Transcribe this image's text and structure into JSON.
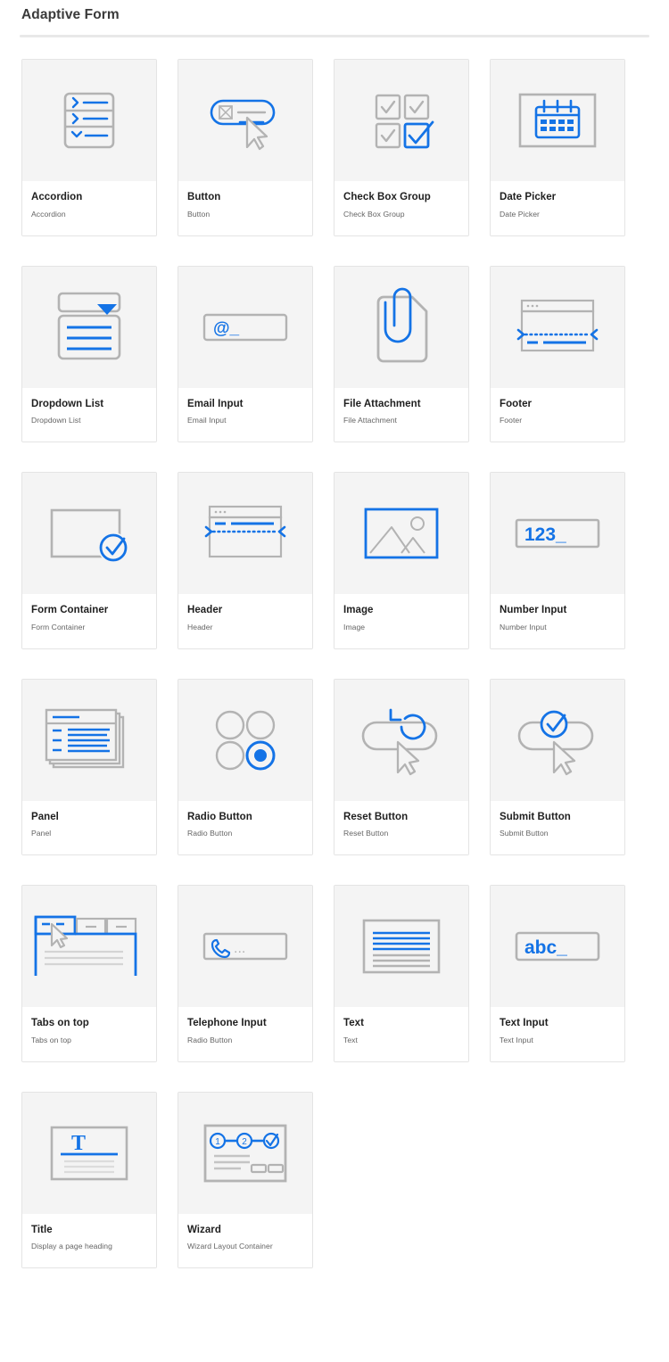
{
  "header": {
    "title": "Adaptive Form"
  },
  "colors": {
    "accent_blue": "#1473e6",
    "icon_gray": "#b3b3b3",
    "thumb_bg": "#f4f4f4",
    "card_border": "#e4e4e4",
    "title_text": "#1f1f1f",
    "sub_text": "#646464",
    "rule": "#e8e8e8"
  },
  "cards": [
    {
      "icon": "accordion-icon",
      "title": "Accordion",
      "subtitle": "Accordion"
    },
    {
      "icon": "button-icon",
      "title": "Button",
      "subtitle": "Button"
    },
    {
      "icon": "check-box-group-icon",
      "title": "Check Box Group",
      "subtitle": "Check Box Group"
    },
    {
      "icon": "date-picker-icon",
      "title": "Date Picker",
      "subtitle": "Date Picker"
    },
    {
      "icon": "dropdown-list-icon",
      "title": "Dropdown List",
      "subtitle": "Dropdown List"
    },
    {
      "icon": "email-input-icon",
      "title": "Email Input",
      "subtitle": "Email Input"
    },
    {
      "icon": "file-attachment-icon",
      "title": "File Attachment",
      "subtitle": "File Attachment"
    },
    {
      "icon": "footer-icon",
      "title": "Footer",
      "subtitle": "Footer"
    },
    {
      "icon": "form-container-icon",
      "title": "Form Container",
      "subtitle": "Form Container"
    },
    {
      "icon": "header-icon",
      "title": "Header",
      "subtitle": "Header"
    },
    {
      "icon": "image-icon",
      "title": "Image",
      "subtitle": "Image"
    },
    {
      "icon": "number-input-icon",
      "title": "Number Input",
      "subtitle": "Number Input"
    },
    {
      "icon": "panel-icon",
      "title": "Panel",
      "subtitle": "Panel"
    },
    {
      "icon": "radio-button-icon",
      "title": "Radio Button",
      "subtitle": "Radio Button"
    },
    {
      "icon": "reset-button-icon",
      "title": "Reset Button",
      "subtitle": "Reset Button"
    },
    {
      "icon": "submit-button-icon",
      "title": "Submit Button",
      "subtitle": "Submit Button"
    },
    {
      "icon": "tabs-on-top-icon",
      "title": "Tabs on top",
      "subtitle": "Tabs on top"
    },
    {
      "icon": "telephone-input-icon",
      "title": "Telephone Input",
      "subtitle": "Radio Button"
    },
    {
      "icon": "text-icon",
      "title": "Text",
      "subtitle": "Text"
    },
    {
      "icon": "text-input-icon",
      "title": "Text Input",
      "subtitle": "Text Input"
    },
    {
      "icon": "title-icon",
      "title": "Title",
      "subtitle": "Display a page heading"
    },
    {
      "icon": "wizard-icon",
      "title": "Wizard",
      "subtitle": "Wizard Layout Container"
    }
  ],
  "icon_text": {
    "email_placeholder": "@_",
    "number_placeholder": "123_",
    "text_placeholder": "abc_",
    "telephone_placeholder": "...",
    "title_glyph": "T",
    "wizard_steps": [
      "1",
      "2"
    ]
  }
}
